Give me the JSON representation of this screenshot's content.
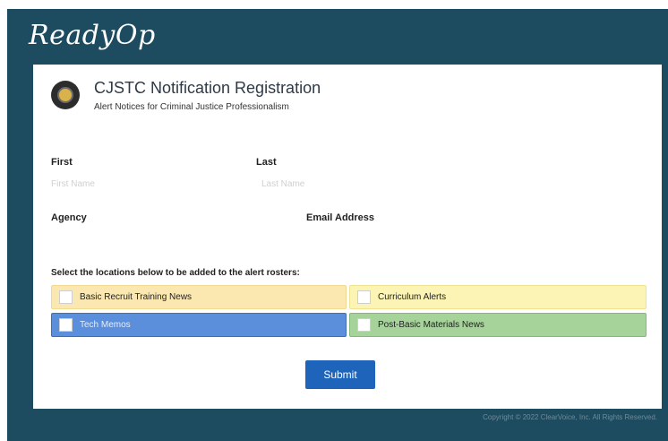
{
  "brand": {
    "logo_text": "ReadyOp"
  },
  "header": {
    "title": "CJSTC Notification Registration",
    "subtitle": "Alert Notices for Criminal Justice Professionalism"
  },
  "form": {
    "first": {
      "label": "First",
      "placeholder": "First Name"
    },
    "last": {
      "label": "Last",
      "placeholder": "Last Name"
    },
    "agency": {
      "label": "Agency",
      "placeholder": ""
    },
    "email": {
      "label": "Email Address",
      "placeholder": ""
    },
    "locations_prompt": "Select the locations below to be added to the alert rosters:",
    "options": [
      {
        "label": "Basic Recruit Training News",
        "color": "#fbe7b0",
        "checked": false
      },
      {
        "label": "Curriculum Alerts",
        "color": "#fbf4b4",
        "checked": false
      },
      {
        "label": "Tech Memos",
        "color": "#5b8edb",
        "checked": false
      },
      {
        "label": "Post-Basic Materials News",
        "color": "#a5d39a",
        "checked": false
      }
    ],
    "submit_label": "Submit"
  },
  "footer": {
    "copyright": "Copyright © 2022 ClearVoice, Inc. All Rights Reserved."
  },
  "colors": {
    "frame": "#1d4b60",
    "submit": "#1e64ba"
  }
}
